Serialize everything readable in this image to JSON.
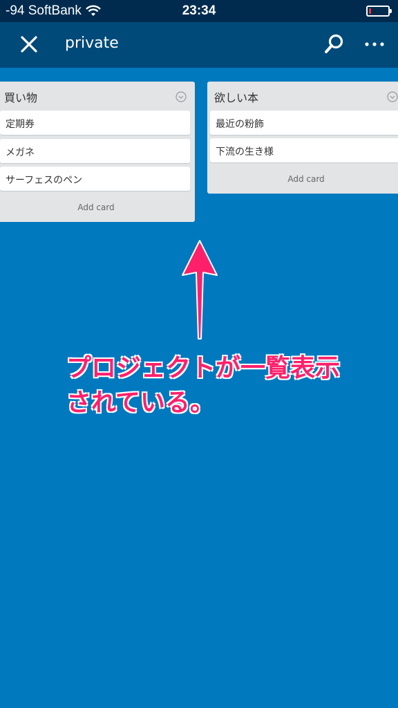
{
  "status_bar": {
    "carrier": "-94 SoftBank",
    "time": "23:34",
    "battery_level_fraction": 0.1
  },
  "nav": {
    "title": "private",
    "icons": [
      "close-icon",
      "search-icon",
      "more-icon"
    ]
  },
  "lists": [
    {
      "title": "買い物",
      "cards": [
        "定期券",
        "メガネ",
        "サーフェスのペン"
      ],
      "add_card_label": "Add card"
    },
    {
      "title": "欲しい本",
      "cards": [
        "最近の粉飾",
        "下流の生き様"
      ],
      "add_card_label": "Add card"
    }
  ],
  "annotation": {
    "line1": "プロジェクトが一覧表示",
    "line2": "されている。"
  },
  "colors": {
    "board_background": "#0079bf",
    "nav_background": "#004a7a",
    "status_background": "#002b4f",
    "list_background": "#e2e4e6",
    "annotation": "#ff1f6a"
  }
}
